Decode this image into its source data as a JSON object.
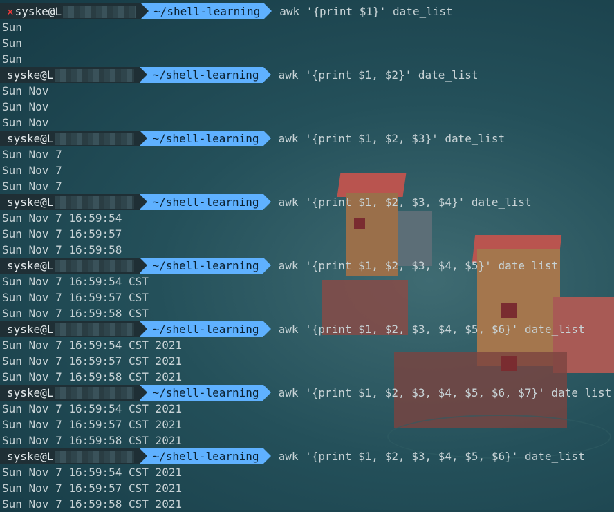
{
  "prompt": {
    "user": "syske@L",
    "error_icon": "x-icon",
    "path": "~/shell-learning"
  },
  "blocks": [
    {
      "cmd": "awk '{print $1}' date_list",
      "failed": true,
      "out": [
        "Sun",
        "Sun",
        "Sun"
      ]
    },
    {
      "cmd": "awk '{print $1, $2}' date_list",
      "out": [
        "Sun Nov",
        "Sun Nov",
        "Sun Nov"
      ]
    },
    {
      "cmd": "awk '{print $1, $2, $3}' date_list",
      "out": [
        "Sun Nov 7",
        "Sun Nov 7",
        "Sun Nov 7"
      ]
    },
    {
      "cmd": "awk '{print $1, $2, $3, $4}' date_list",
      "out": [
        "Sun Nov 7 16:59:54",
        "Sun Nov 7 16:59:57",
        "Sun Nov 7 16:59:58"
      ]
    },
    {
      "cmd": "awk '{print $1, $2, $3, $4, $5}' date_list",
      "out": [
        "Sun Nov 7 16:59:54 CST",
        "Sun Nov 7 16:59:57 CST",
        "Sun Nov 7 16:59:58 CST"
      ]
    },
    {
      "cmd": "awk '{print $1, $2, $3, $4, $5, $6}' date_list",
      "out": [
        "Sun Nov 7 16:59:54 CST 2021",
        "Sun Nov 7 16:59:57 CST 2021",
        "Sun Nov 7 16:59:58 CST 2021"
      ]
    },
    {
      "cmd": "awk '{print $1, $2, $3, $4, $5, $6, $7}' date_list",
      "out": [
        "Sun Nov 7 16:59:54 CST 2021",
        "Sun Nov 7 16:59:57 CST 2021",
        "Sun Nov 7 16:59:58 CST 2021"
      ]
    },
    {
      "cmd": "awk '{print $1, $2, $3, $4, $5, $6}' date_list",
      "out": [
        "Sun Nov 7 16:59:54 CST 2021",
        "Sun Nov 7 16:59:57 CST 2021",
        "Sun Nov 7 16:59:58 CST 2021"
      ]
    }
  ],
  "colors": {
    "path_segment": "#5fb1ff",
    "user_segment": "#1f2f35",
    "error": "#ff3b3b",
    "text": "#c8d3d6"
  }
}
